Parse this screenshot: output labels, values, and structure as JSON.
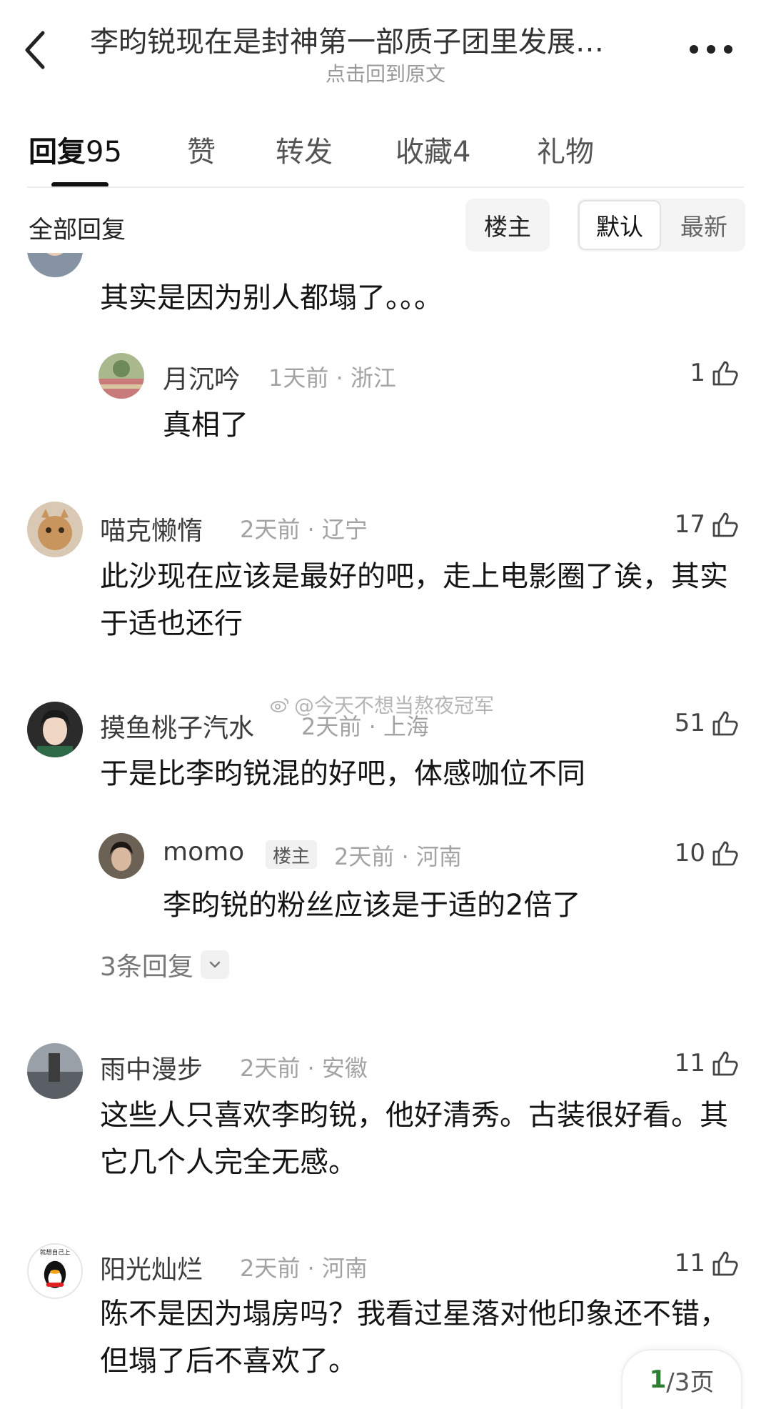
{
  "header": {
    "title": "李昀锐现在是封神第一部质子团里发展…",
    "subtitle": "点击回到原文"
  },
  "tabs": [
    {
      "label": "回复",
      "count": "95"
    },
    {
      "label": "赞",
      "count": ""
    },
    {
      "label": "转发",
      "count": ""
    },
    {
      "label": "收藏",
      "count": "4"
    },
    {
      "label": "礼物",
      "count": ""
    }
  ],
  "filter": {
    "title": "全部回复",
    "op_only": "楼主",
    "sort_default": "默认",
    "sort_new": "最新"
  },
  "watermark": "@今天不想当熬夜冠军",
  "comments": [
    {
      "text": "其实是因为别人都塌了。。。"
    },
    {
      "user": "月沉吟",
      "time": "1天前",
      "location": "浙江",
      "likes": "1",
      "text": "真相了"
    },
    {
      "user": "喵克懒惰",
      "time": "2天前",
      "location": "辽宁",
      "likes": "17",
      "text": "此沙现在应该是最好的吧，走上电影圈了诶，其实于适也还行"
    },
    {
      "user": "摸鱼桃子汽水",
      "time": "2天前",
      "location": "上海",
      "likes": "51",
      "text": "于是比李昀锐混的好吧，体感咖位不同"
    },
    {
      "user": "momo",
      "badge": "楼主",
      "time": "2天前",
      "location": "河南",
      "likes": "10",
      "text": "李昀锐的粉丝应该是于适的2倍了"
    },
    {
      "more_replies": "3条回复"
    },
    {
      "user": "雨中漫步",
      "time": "2天前",
      "location": "安徽",
      "likes": "11",
      "text": "这些人只喜欢李昀锐，他好清秀。古装很好看。其它几个人完全无感。"
    },
    {
      "user": "阳光灿烂",
      "avatar_caption": "就想自己上",
      "time": "2天前",
      "location": "河南",
      "likes": "11",
      "text": "陈不是因为塌房吗？我看过星落对他印象还不错，但塌了后不喜欢了。"
    }
  ],
  "separator": " · ",
  "pager": {
    "current": "1",
    "total": "/3页"
  },
  "icons": [
    "back-icon",
    "more-icon",
    "thumbs-up-icon",
    "chevron-down-icon",
    "weibo-icon"
  ]
}
